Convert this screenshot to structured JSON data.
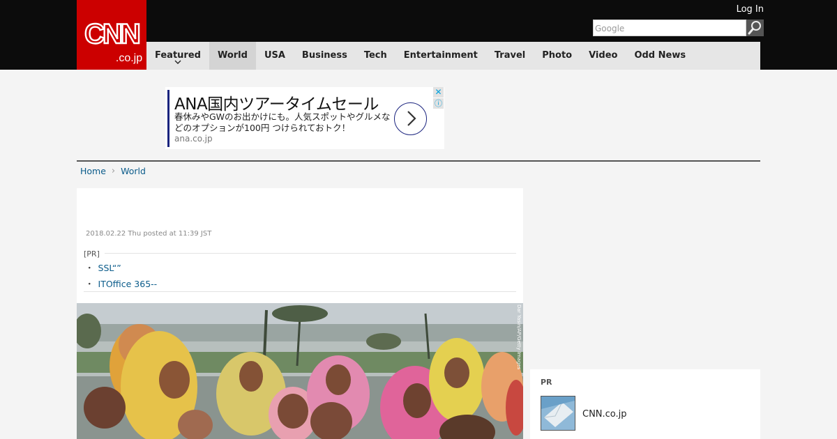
{
  "header": {
    "logo_text": "CNN .co.jp",
    "login_label": "Log In",
    "search_placeholder": "Google",
    "search_icon": "magnifier-icon"
  },
  "nav": {
    "items": [
      {
        "label": "Featured",
        "has_dropdown": true
      },
      {
        "label": "World",
        "active": true
      },
      {
        "label": "USA"
      },
      {
        "label": "Business"
      },
      {
        "label": "Tech"
      },
      {
        "label": "Entertainment"
      },
      {
        "label": "Travel"
      },
      {
        "label": "Photo"
      },
      {
        "label": "Video"
      },
      {
        "label": "Odd News"
      }
    ]
  },
  "ad": {
    "title": "ANA国内ツアータイムセール",
    "body": "春休みやGWのお出かけにも。人気スポットやグルメなどのオプションが100円 つけられておトク！",
    "url": "ana.co.jp",
    "arrow_icon": "chevron-right-icon",
    "close_icon": "close-icon",
    "info_icon": "info-icon"
  },
  "breadcrumb": {
    "home": "Home",
    "separator": "›",
    "current": "World"
  },
  "article": {
    "date": "2018.02.22 Thu posted at 11:39 JST",
    "pr_label": "[PR]",
    "pr_links": [
      "SSL“”",
      "ITOffice 365--"
    ],
    "bullet": "・",
    "photo_credit": "Dar Yasin/AP/Getty Images"
  },
  "sidebar": {
    "pr_label": "PR",
    "item_text": "CNN.co.jp"
  },
  "colors": {
    "brand_red": "#cc0000",
    "topbar": "#0c0c0c",
    "nav_bg": "#e6e6e6",
    "link": "#0a5b8a",
    "ad_accent": "#1a237e"
  }
}
